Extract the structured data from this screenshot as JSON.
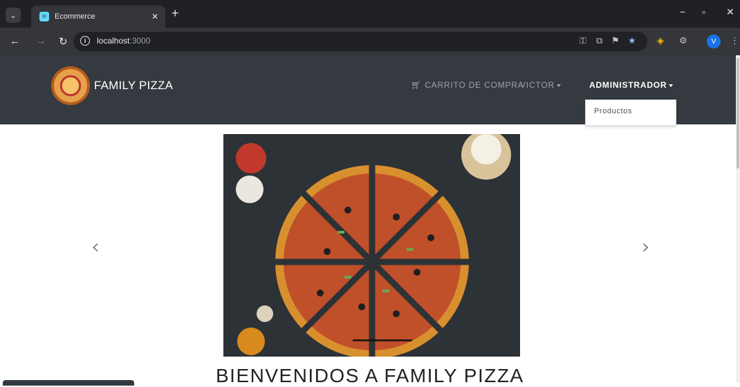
{
  "browser": {
    "tab_title": "Ecommerce",
    "url_host": "localhost",
    "url_port": ":3000",
    "profile_initial": "V"
  },
  "navbar": {
    "brand": "FAMILY PIZZA",
    "cart": "CARRITO DE COMPRA",
    "user": "VICTOR",
    "admin": "ADMINISTRADOR"
  },
  "dropdown": {
    "items": [
      "Productos"
    ]
  },
  "carousel": {
    "prev_icon": "chevron-left-icon",
    "next_icon": "chevron-right-icon"
  },
  "main": {
    "heading": "BIENVENIDOS A FAMILY PIZZA"
  },
  "colors": {
    "navbar_bg": "#343a40",
    "chrome_bg": "#202124"
  }
}
